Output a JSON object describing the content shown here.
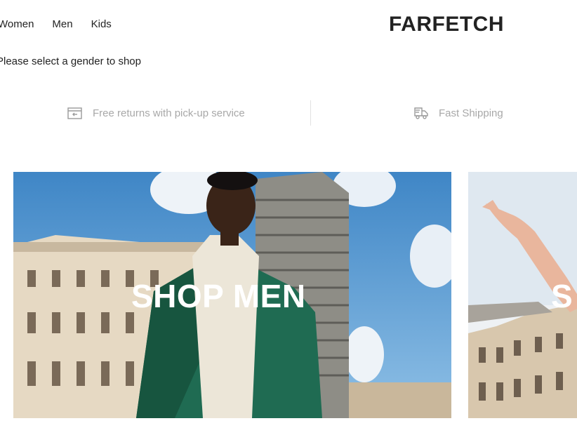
{
  "nav": {
    "items": [
      {
        "label": "Women"
      },
      {
        "label": "Men"
      },
      {
        "label": "Kids"
      }
    ]
  },
  "brand": {
    "logo_text": "FARFETCH"
  },
  "prompt": {
    "text": "Please select a gender to shop"
  },
  "usp": {
    "returns": {
      "label": "Free returns with pick-up service",
      "icon": "returns-box-icon"
    },
    "shipping": {
      "label": "Fast Shipping",
      "icon": "delivery-truck-icon"
    }
  },
  "banners": {
    "men": {
      "label": "SHOP MEN"
    },
    "women": {
      "label": "S"
    }
  },
  "colors": {
    "text": "#222222",
    "muted": "#a8a8a8",
    "banner_text": "#ffffff"
  }
}
